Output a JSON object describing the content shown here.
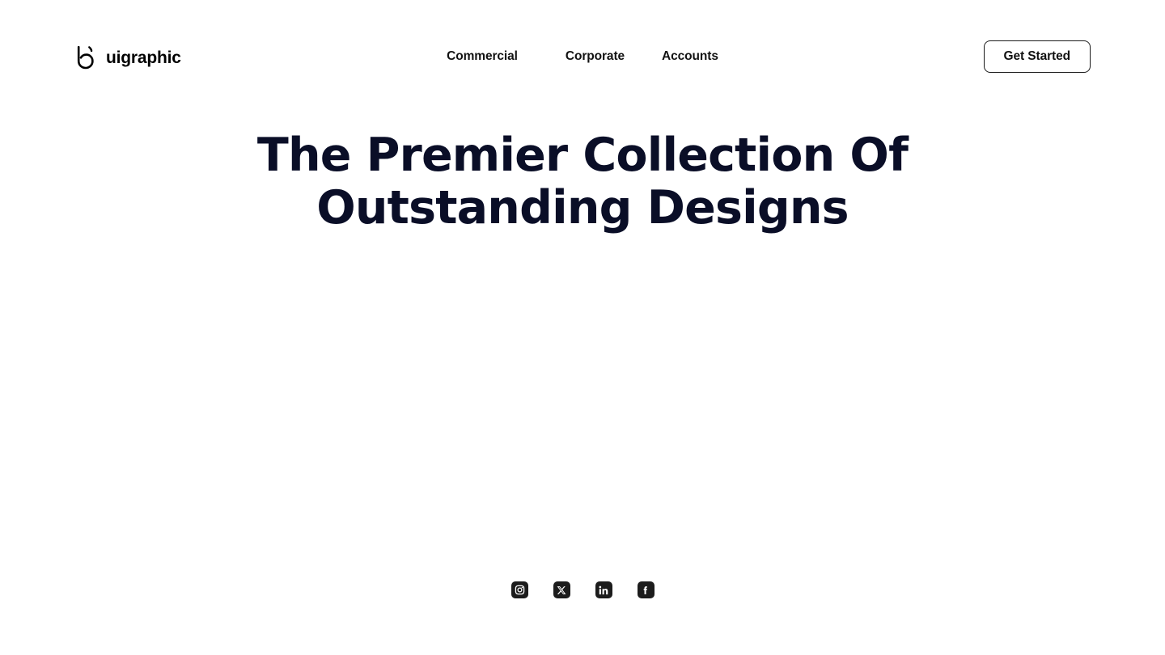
{
  "brand": {
    "name": "uigraphic",
    "mark_icon": "uigraphic-logo-mark"
  },
  "nav": {
    "items": [
      {
        "label": "Commercial"
      },
      {
        "label": "Corporate"
      },
      {
        "label": "Accounts"
      }
    ]
  },
  "cta": {
    "label": "Get Started"
  },
  "hero": {
    "line1": "The Premier Collection Of",
    "line2": "Outstanding Designs",
    "color": "#0A0E27"
  },
  "social": {
    "items": [
      {
        "name": "instagram-icon",
        "label": "Instagram"
      },
      {
        "name": "x-twitter-icon",
        "label": "X"
      },
      {
        "name": "linkedin-icon",
        "label": "LinkedIn"
      },
      {
        "name": "facebook-icon",
        "label": "Facebook"
      }
    ],
    "tile_color": "#1c1c1c",
    "glyph_color": "#ffffff"
  },
  "theme": {
    "background": "#ffffff",
    "text": "#121212",
    "border": "#1b1b1b"
  }
}
